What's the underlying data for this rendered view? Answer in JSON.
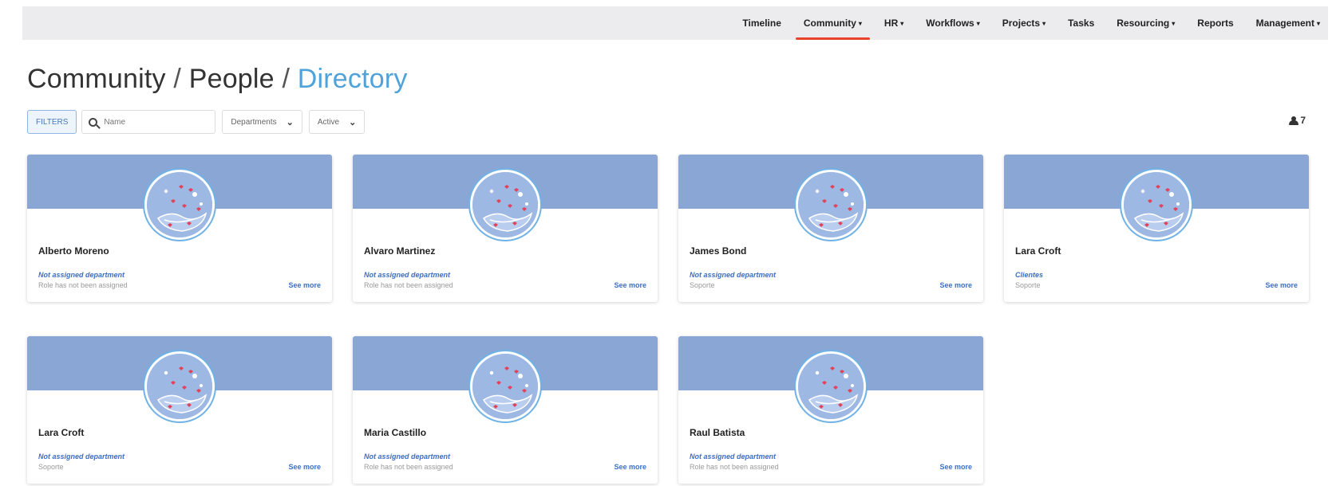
{
  "nav": {
    "items": [
      {
        "label": "Timeline",
        "dropdown": false,
        "active": false
      },
      {
        "label": "Community",
        "dropdown": true,
        "active": true
      },
      {
        "label": "HR",
        "dropdown": true,
        "active": false
      },
      {
        "label": "Workflows",
        "dropdown": true,
        "active": false
      },
      {
        "label": "Projects",
        "dropdown": true,
        "active": false
      },
      {
        "label": "Tasks",
        "dropdown": false,
        "active": false
      },
      {
        "label": "Resourcing",
        "dropdown": true,
        "active": false
      },
      {
        "label": "Reports",
        "dropdown": false,
        "active": false
      },
      {
        "label": "Management",
        "dropdown": true,
        "active": false
      }
    ],
    "active_color": "#e8412c"
  },
  "breadcrumb": {
    "part1": "Community",
    "part2": "People",
    "current": "Directory",
    "separator": "/"
  },
  "filters": {
    "filters_label": "FILTERS",
    "search_placeholder": "Name",
    "department_label": "Departments",
    "status_label": "Active"
  },
  "users_count": "7",
  "people": [
    {
      "name": "Alberto Moreno",
      "department": "Not assigned department",
      "role": "Role has not been assigned",
      "see_more": "See more"
    },
    {
      "name": "Alvaro Martinez",
      "department": "Not assigned department",
      "role": "Role has not been assigned",
      "see_more": "See more"
    },
    {
      "name": "James Bond",
      "department": "Not assigned department",
      "role": "Soporte",
      "see_more": "See more"
    },
    {
      "name": "Lara Croft",
      "department": "Clientes",
      "role": "Soporte",
      "see_more": "See more"
    },
    {
      "name": "Lara Croft",
      "department": "Not assigned department",
      "role": "Soporte",
      "see_more": "See more"
    },
    {
      "name": "Maria Castillo",
      "department": "Not assigned department",
      "role": "Role has not been assigned",
      "see_more": "See more"
    },
    {
      "name": "Raul Batista",
      "department": "Not assigned department",
      "role": "Role has not been assigned",
      "see_more": "See more"
    }
  ],
  "colors": {
    "banner": "#8aa6d4",
    "link": "#3a6fc4",
    "breadcrumb_current": "#4fa3d9"
  }
}
